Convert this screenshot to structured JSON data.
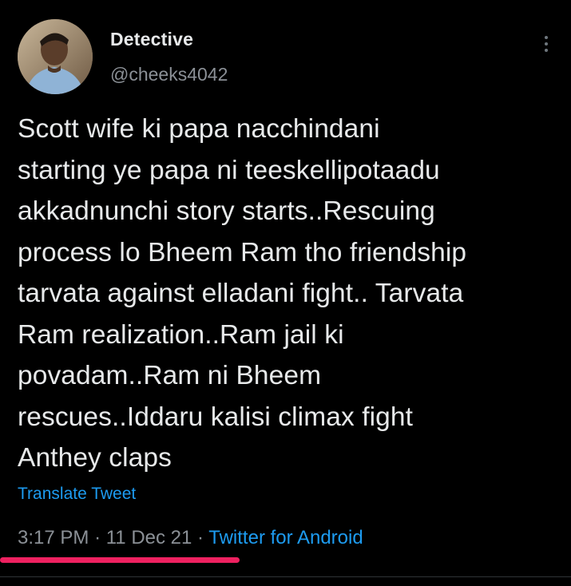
{
  "tweet": {
    "author": {
      "display_name": "Detective",
      "handle": "@cheeks4042",
      "avatar_icon": "profile-photo"
    },
    "more_icon": "more-vertical-icon",
    "text": "Scott wife ki papa nacchindani\nstarting ye papa ni teeskellipotaadu\nakkadnunchi story starts..Rescuing\nprocess lo Bheem Ram tho friendship\ntarvata against elladani fight.. Tarvata\nRam realization..Ram jail ki\npovadam..Ram ni Bheem\nrescues..Iddaru kalisi climax fight\nAnthey claps",
    "translate_label": "Translate Tweet",
    "time": "3:17 PM",
    "separator": "·",
    "date": "11 Dec 21",
    "client": "Twitter for Android"
  },
  "colors": {
    "background": "#000000",
    "text_primary": "#e7e9ea",
    "text_secondary": "#8b9096",
    "link": "#1d9bf0",
    "highlight_mark": "#ee2160"
  }
}
